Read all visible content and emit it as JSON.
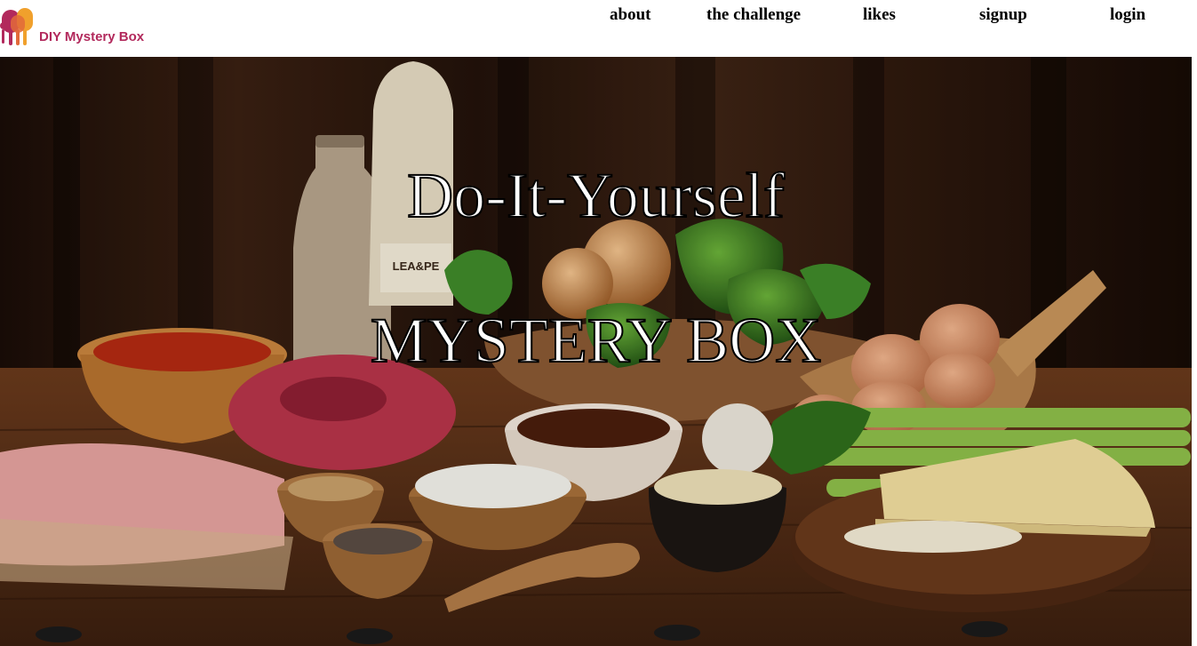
{
  "brand": {
    "name": "DIY Mystery Box",
    "color": "#b2295c"
  },
  "nav": {
    "items": [
      "about",
      "the challenge",
      "likes",
      "signup",
      "login"
    ]
  },
  "hero": {
    "line1": "Do-It-Yourself",
    "line2": "MYSTERY BOX",
    "bottle_label": "LEA&PE"
  }
}
